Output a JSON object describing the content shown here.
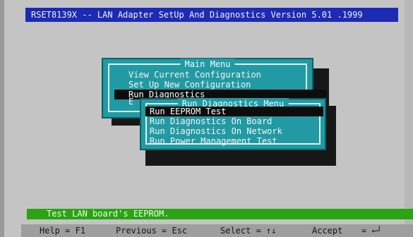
{
  "title": "RSET8139X -- LAN Adapter SetUp And Diagnostics Version 5.01 .1999",
  "main_menu": {
    "title": "Main Menu",
    "items": [
      {
        "label": "View Current Configuration"
      },
      {
        "label": "Set Up New Configuration"
      },
      {
        "label": "Run Diagnostics"
      }
    ],
    "partial_item": "E",
    "selected_index": 2
  },
  "diagnostics_menu": {
    "title": "Run Diagnostics Menu",
    "items": [
      {
        "label": "Run EEPROM Test"
      },
      {
        "label": "Run Diagnostics On Board"
      },
      {
        "label": "Run Diagnostics On Network"
      },
      {
        "label": "Run Power Management Test"
      }
    ],
    "selected_index": 0
  },
  "status_text": "Test LAN board's EEPROM.",
  "hints": {
    "help": "Help = F1",
    "previous": "Previous = Esc",
    "select": "Select = ↑↓",
    "accept": "Accept",
    "accept_key": "= ←┘"
  },
  "colors": {
    "title_bg": "#1c2ab4",
    "menu_bg": "#229aa4",
    "status_bg": "#2ba314",
    "selected_bg": "#0d0d0d",
    "screen_bg": "#c4c4c4"
  }
}
